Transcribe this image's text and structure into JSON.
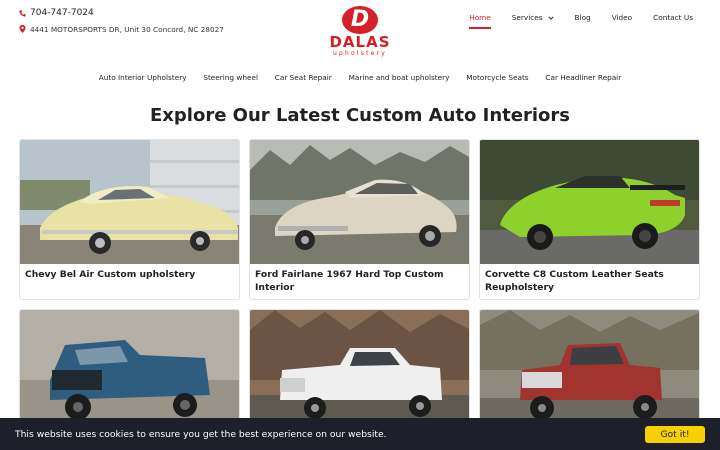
{
  "header": {
    "phone": "704-747-7024",
    "address": "4441 MOTORSPORTS DR, Unit 30 Concord, NC 28027",
    "logo_name": "DALAS",
    "logo_sub": "upholstery",
    "logo_letter": "D"
  },
  "nav": {
    "items": [
      {
        "label": "Home"
      },
      {
        "label": "Services"
      },
      {
        "label": "Blog"
      },
      {
        "label": "Video"
      },
      {
        "label": "Contact Us"
      }
    ]
  },
  "subnav": {
    "items": [
      {
        "label": "Auto Interior Upholstery"
      },
      {
        "label": "Steering wheel"
      },
      {
        "label": "Car Seat Repair"
      },
      {
        "label": "Marine and boat upholstery"
      },
      {
        "label": "Motorcycle Seats"
      },
      {
        "label": "Car Headliner Repair"
      }
    ]
  },
  "main": {
    "heading": "Explore Our Latest Custom Auto Interiors",
    "cards": [
      {
        "title": "Chevy Bel Air Custom upholstery"
      },
      {
        "title": "Ford Fairlane 1967 Hard Top Custom Interior"
      },
      {
        "title": "Corvette C8 Custom Leather Seats Reupholstery"
      },
      {
        "title": ""
      },
      {
        "title": ""
      },
      {
        "title": ""
      }
    ]
  },
  "cookie": {
    "text": "This website uses cookies to ensure you get the best experience on our website.",
    "button": "Got it!"
  },
  "colors": {
    "brand_red": "#d62027",
    "cookie_bg": "#1d1f2b",
    "cookie_button": "#f6d000"
  }
}
